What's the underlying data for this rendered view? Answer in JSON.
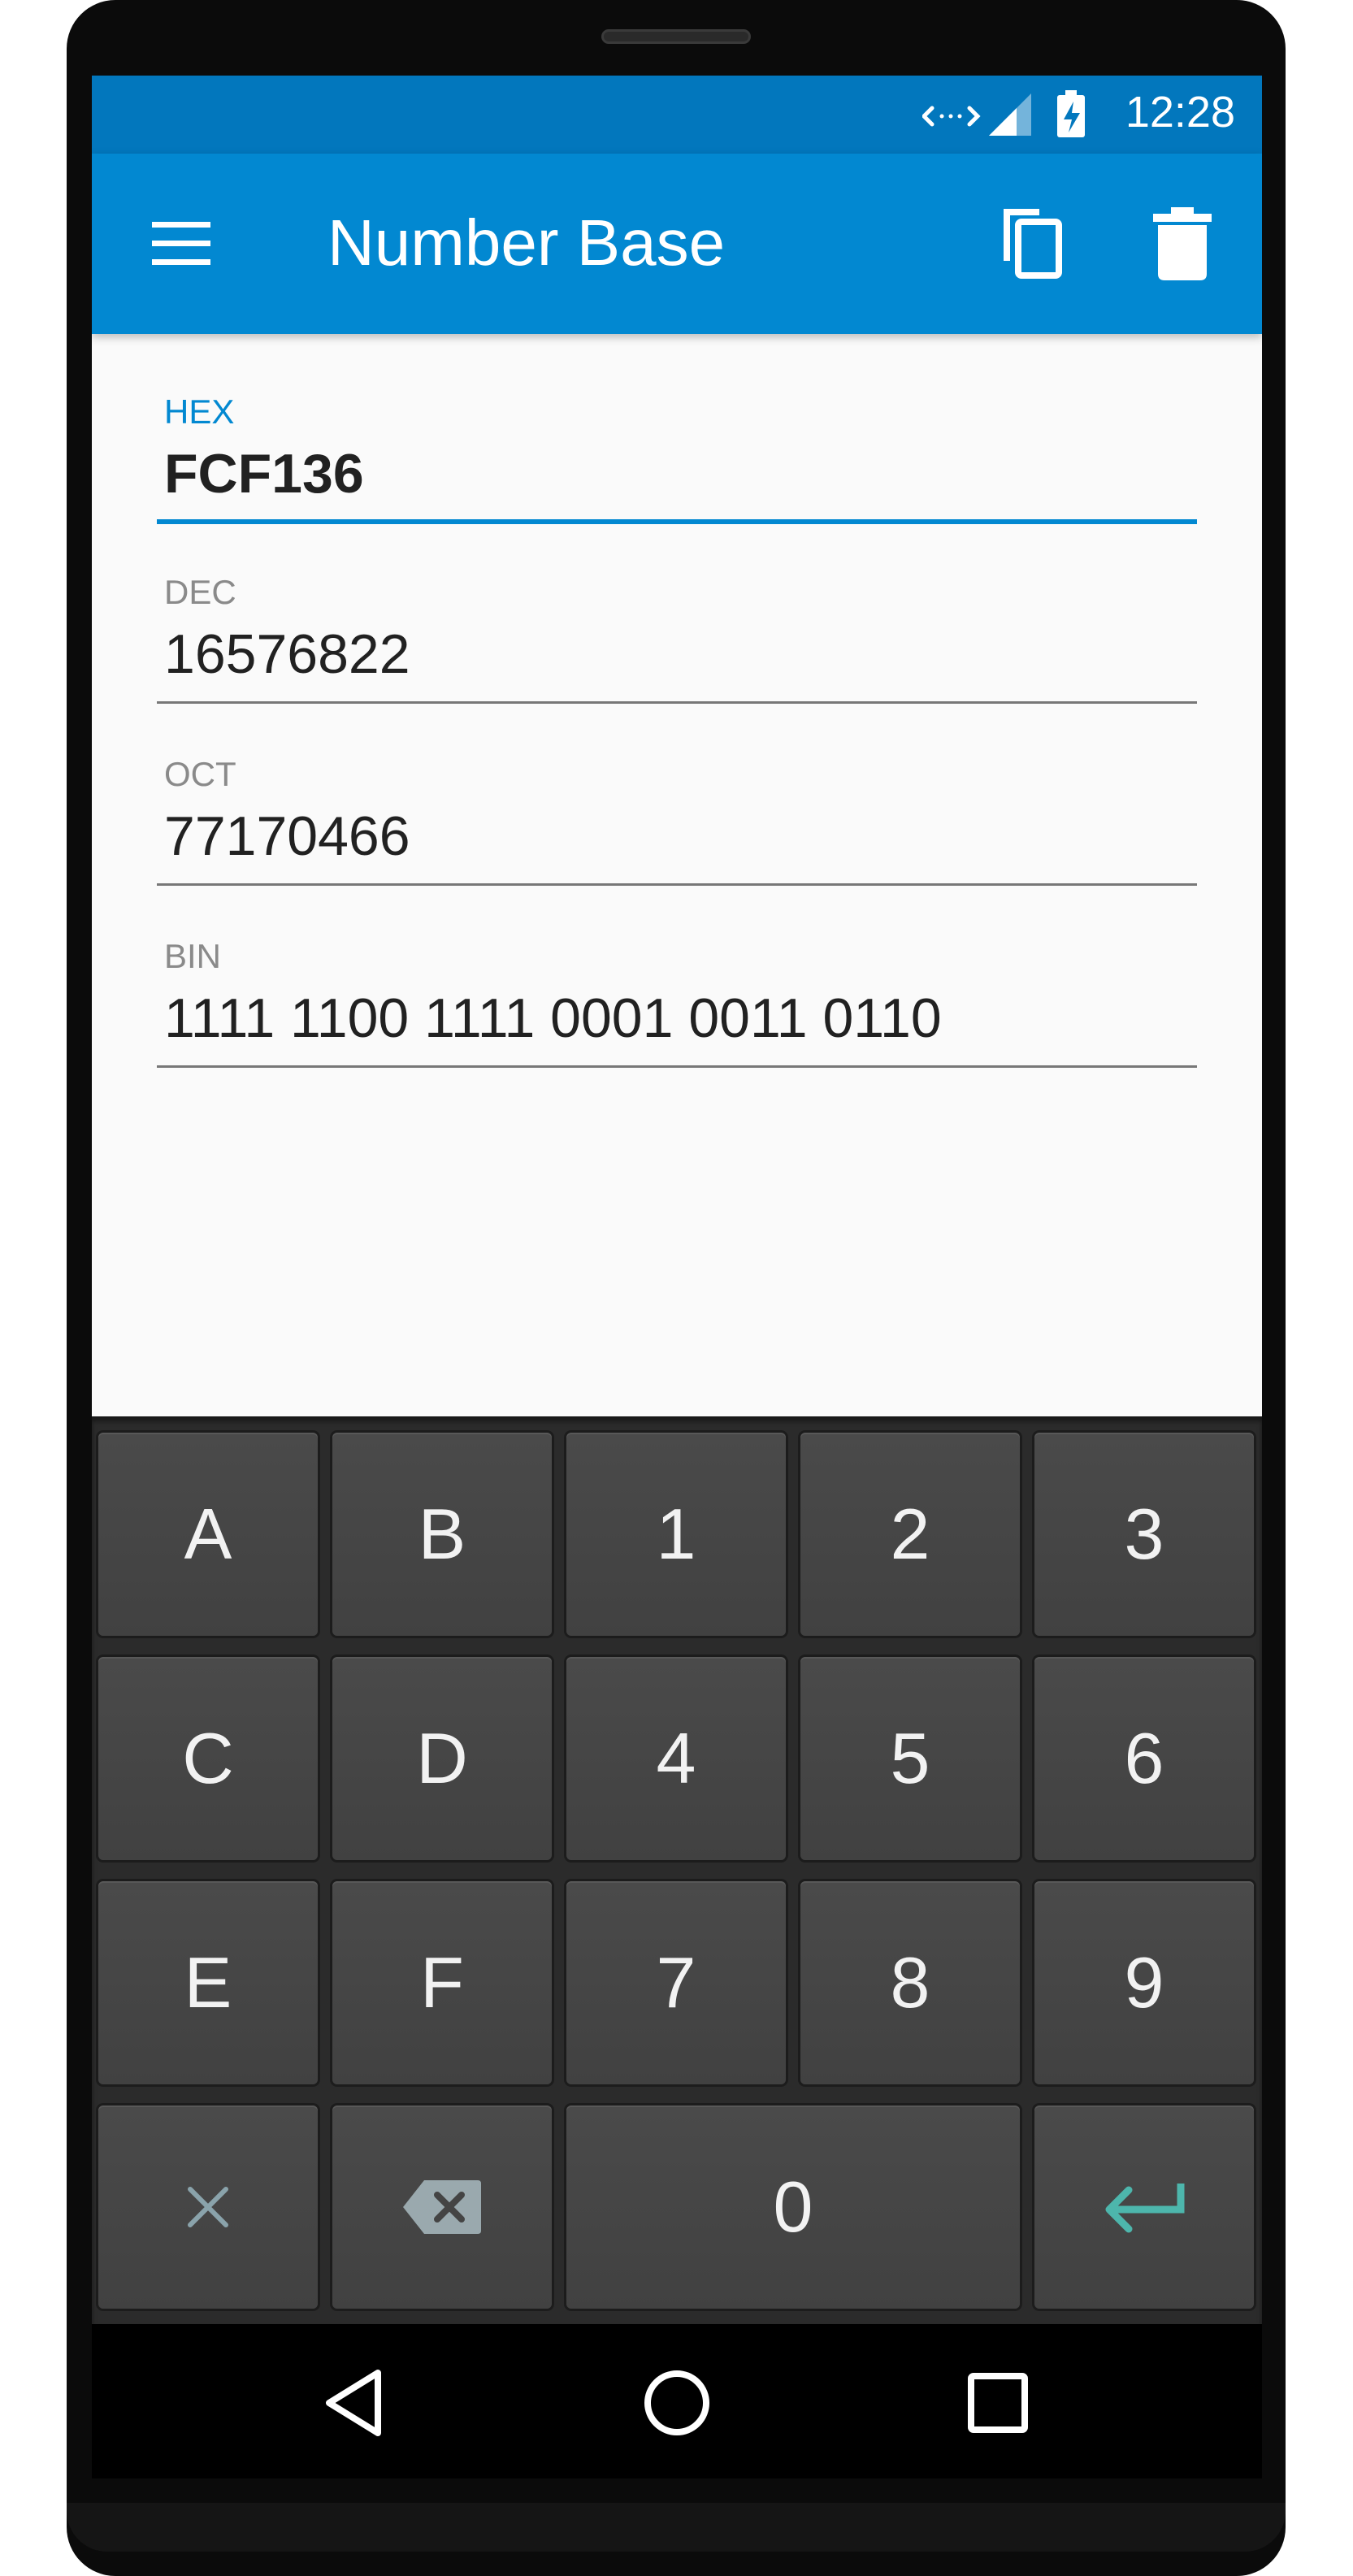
{
  "status_bar": {
    "time": "12:28",
    "icons": [
      "data-sync-icon",
      "cell-signal-icon",
      "battery-charging-icon"
    ]
  },
  "app_bar": {
    "title": "Number Base",
    "actions": [
      "menu-icon",
      "copy-icon",
      "delete-icon"
    ]
  },
  "fields": [
    {
      "label": "HEX",
      "value": "FCF136",
      "active": true
    },
    {
      "label": "DEC",
      "value": "16576822",
      "active": false
    },
    {
      "label": "OCT",
      "value": "77170466",
      "active": false
    },
    {
      "label": "BIN",
      "value": "1111 1100 1111 0001 0011 0110",
      "active": false
    }
  ],
  "keypad": {
    "rows": [
      [
        "A",
        "B",
        "1",
        "2",
        "3"
      ],
      [
        "C",
        "D",
        "4",
        "5",
        "6"
      ],
      [
        "E",
        "F",
        "7",
        "8",
        "9"
      ]
    ],
    "bottom_row": {
      "clear_icon": "close-icon",
      "backspace_icon": "backspace-icon",
      "zero": "0",
      "enter_icon": "enter-icon"
    }
  },
  "colors": {
    "status_bar": "#0277bd",
    "app_bar": "#0288d1",
    "accent": "#0288d1",
    "enter_key": "#4db6ac",
    "key_face": "#444444"
  },
  "nav_bar": {
    "buttons": [
      "back-icon",
      "home-icon",
      "recents-icon"
    ]
  }
}
